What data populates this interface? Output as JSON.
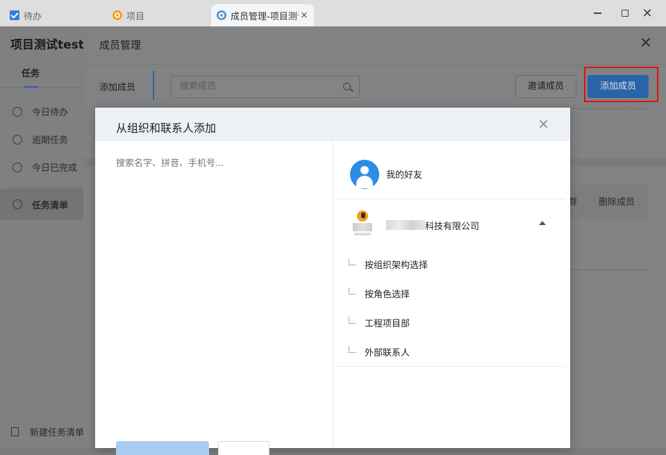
{
  "tabs": [
    {
      "label": "待办"
    },
    {
      "label": "项目"
    },
    {
      "label": "成员管理-项目测试"
    }
  ],
  "window": {
    "close_symbol": "✕",
    "tab_close_symbol": "×"
  },
  "sidebar": {
    "project_title": "项目测试test",
    "tab_task": "任务",
    "items": [
      {
        "label": "今日待办"
      },
      {
        "label": "逾期任务"
      },
      {
        "label": "今日已完成"
      },
      {
        "label": "任务清单"
      }
    ],
    "bottom": "新建任务清单"
  },
  "panel": {
    "title": "成员管理",
    "close_symbol": "✕",
    "side_label": "添加成员",
    "search_placeholder": "搜索成员",
    "invite_button": "邀请成员",
    "add_button": "添加成员",
    "action_group": "群",
    "action_delete": "删除成员"
  },
  "modal": {
    "title": "从组织和联系人添加",
    "close_symbol": "×",
    "search_placeholder": "搜索名字、拼音、手机号...",
    "friends_label": "我的好友",
    "org_name": "科技有限公司",
    "org_items": [
      {
        "label": "按组织架构选择"
      },
      {
        "label": "按角色选择"
      },
      {
        "label": "工程项目部"
      },
      {
        "label": "外部联系人"
      }
    ]
  },
  "colors": {
    "accent": "#2d8ce6",
    "highlight_frame": "#e01010",
    "logo_orange": "#f0a11f"
  }
}
